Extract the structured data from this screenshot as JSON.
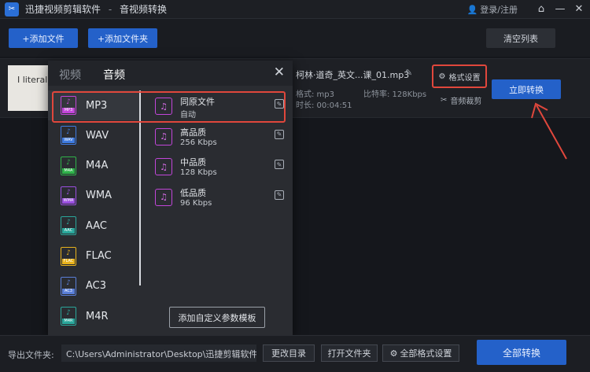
{
  "titlebar": {
    "app_name": "迅捷视频剪辑软件",
    "separator": "-",
    "section": "音视频转换",
    "login": "登录/注册",
    "home_icon": "home-icon",
    "minimize": "—",
    "close": "✕"
  },
  "toolbar": {
    "add_file": "+添加文件",
    "add_folder": "+添加文件夹",
    "clear_list": "清空列表"
  },
  "file": {
    "thumb_text": "I literally ca",
    "name": "柯林·道奇_英文...课_01.mp3",
    "format_label": "格式: mp3",
    "bitrate_label": "比特率: 128Kbps",
    "duration_label": "时长: 00:04:51",
    "format_settings": "格式设置",
    "audio_cut": "音频裁剪",
    "convert_now": "立即转换"
  },
  "panel": {
    "tab_video": "视频",
    "tab_audio": "音频",
    "close": "✕",
    "formats": [
      {
        "label": "MP3",
        "tag": "MP3",
        "color": "#c246d9",
        "selected": true
      },
      {
        "label": "WAV",
        "tag": "WAV",
        "color": "#3f7be0"
      },
      {
        "label": "M4A",
        "tag": "M4A",
        "color": "#2fb34a"
      },
      {
        "label": "WMA",
        "tag": "WMA",
        "color": "#9a4fe0"
      },
      {
        "label": "AAC",
        "tag": "AAC",
        "color": "#2aa79b"
      },
      {
        "label": "FLAC",
        "tag": "FLAC",
        "color": "#e8b21d"
      },
      {
        "label": "AC3",
        "tag": "AC3",
        "color": "#5a7fd8"
      },
      {
        "label": "M4R",
        "tag": "M4R",
        "color": "#2aa79b"
      }
    ],
    "qualities": [
      {
        "name": "同原文件",
        "sub": "自动"
      },
      {
        "name": "高品质",
        "sub": "256 Kbps"
      },
      {
        "name": "中品质",
        "sub": "128 Kbps"
      },
      {
        "name": "低品质",
        "sub": "96 Kbps"
      }
    ],
    "custom_template": "添加自定义参数模板"
  },
  "bottom": {
    "output_label": "导出文件夹:",
    "output_path": "C:\\Users\\Administrator\\Desktop\\迅捷剪辑软件",
    "change_dir": "更改目录",
    "open_folder": "打开文件夹",
    "all_format_settings": "全部格式设置",
    "convert_all": "全部转换"
  },
  "colors": {
    "accent_blue": "#2461c9",
    "highlight_red": "#e0473c"
  }
}
